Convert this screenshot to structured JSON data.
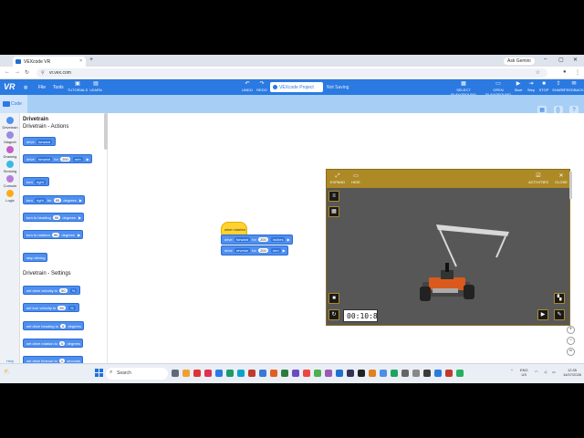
{
  "browser": {
    "tab_title": "VEXcode VR",
    "tab_close": "×",
    "new_tab": "+",
    "url": "vr.vex.com",
    "gemini": "Ask Gemini",
    "minimize": "–",
    "maximize": "▢",
    "close": "✕",
    "back": "←",
    "forward": "→",
    "reload": "↻"
  },
  "vex_header": {
    "logo": "VR",
    "menu_file": "File",
    "menu_tools": "Tools",
    "tutorials": "TUTORIALS",
    "learn": "LEARN",
    "undo": "UNDO",
    "redo": "REDO",
    "project_name": "VEXcode Project",
    "save_status": "Not Saving",
    "select_playground": "SELECT PLAYGROUND",
    "open_playground": "OPEN PLAYGROUND",
    "start": "Start",
    "step": "Step",
    "stop": "STOP",
    "share": "SHARE",
    "feedback": "FEEDBACK"
  },
  "code_tab": "Code",
  "categories": [
    {
      "label": "Drivetrain",
      "color": "#4f8ff0"
    },
    {
      "label": "Magnet",
      "color": "#9b8be0"
    },
    {
      "label": "Drawing",
      "color": "#c45ec4"
    },
    {
      "label": "Sensing",
      "color": "#3cb9e3"
    },
    {
      "label": "Console",
      "color": "#b77ed8"
    },
    {
      "label": "Logic",
      "color": "#ffab19"
    }
  ],
  "help_label": "Help",
  "palette": {
    "drivetrain_title": "Drivetrain",
    "actions_title": "Drivetrain - Actions",
    "settings_title": "Drivetrain - Settings",
    "blocks": {
      "drive": {
        "text": "drive",
        "dd": "forward"
      },
      "drive_for": {
        "text": "drive",
        "dd": "forward",
        "for": "for",
        "num": "200",
        "unit": "mm"
      },
      "turn": {
        "text": "turn",
        "dd": "right"
      },
      "turn_for": {
        "text": "turn",
        "dd": "right",
        "for": "for",
        "num": "90",
        "unit": "degrees"
      },
      "turn_heading": {
        "text": "turn to heading",
        "num": "90",
        "unit": "degrees"
      },
      "turn_rotation": {
        "text": "turn to rotation",
        "num": "90",
        "unit": "degrees"
      },
      "stop": {
        "text": "stop driving"
      },
      "drive_velocity": {
        "text": "set drive velocity to",
        "num": "50",
        "unit": "%"
      },
      "turn_velocity": {
        "text": "set turn velocity to",
        "num": "50",
        "unit": "%"
      },
      "drive_heading": {
        "text": "set drive heading to",
        "num": "0",
        "unit": "degrees"
      },
      "drive_rotation": {
        "text": "set drive rotation to",
        "num": "0",
        "unit": "degrees"
      },
      "drive_timeout": {
        "text": "set drive timeout to",
        "num": "1",
        "unit": "seconds"
      }
    }
  },
  "workspace": {
    "hat_label": "when started",
    "block1": {
      "text": "drive",
      "dd": "forward",
      "for": "for",
      "num": "200",
      "unit": "inches"
    },
    "block2": {
      "text": "drive",
      "dd": "reverse",
      "for": "for",
      "num": "200",
      "unit": "mm"
    }
  },
  "playground": {
    "expand": "EXPAND",
    "hide": "HIDE",
    "activities": "ACTIVITIES",
    "close": "CLOSE",
    "timer": "00:10:8"
  },
  "taskbar": {
    "search_placeholder": "Search",
    "lang_1": "ENG",
    "lang_2": "US",
    "time": "12:35",
    "date": "14/07/2026"
  }
}
